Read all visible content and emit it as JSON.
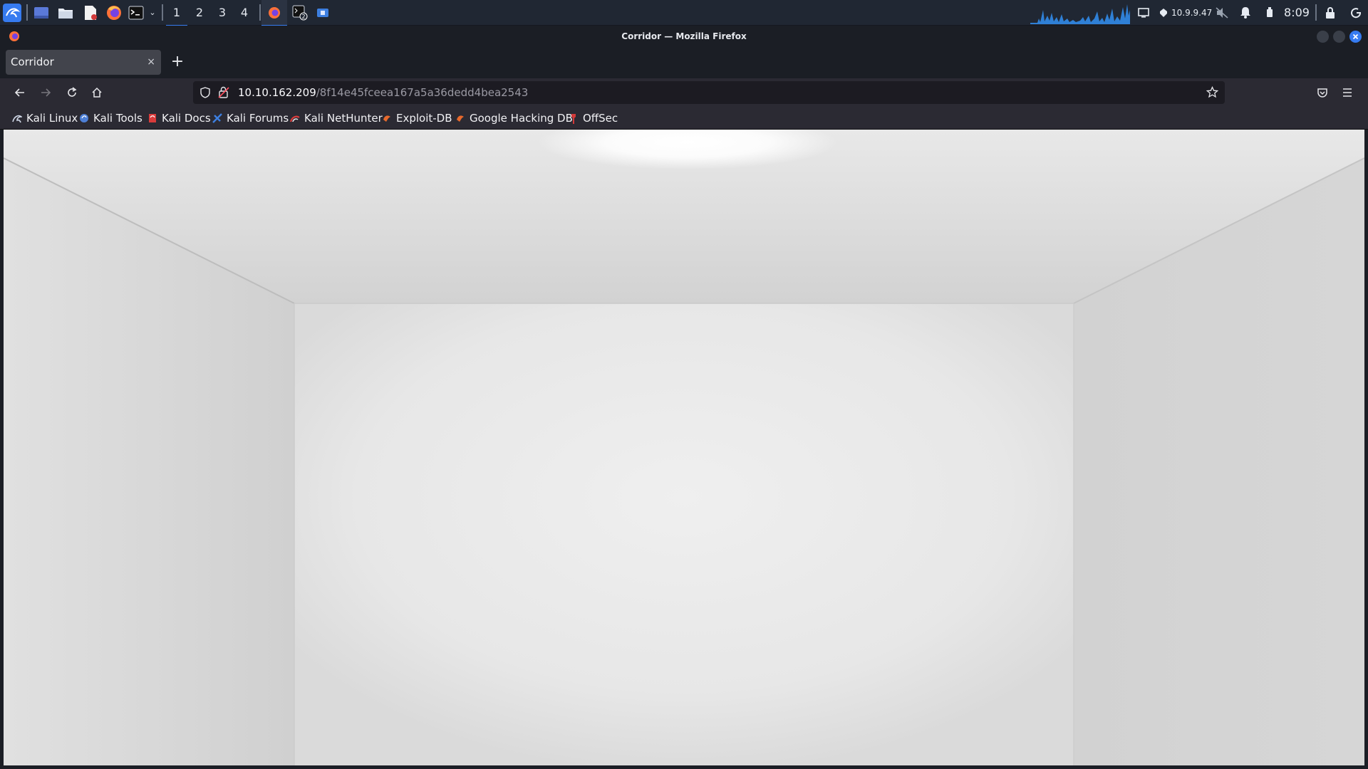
{
  "panel": {
    "workspaces": [
      "1",
      "2",
      "3",
      "4"
    ],
    "active_workspace": "1",
    "ip_address": "10.9.9.47",
    "clock": "8:09",
    "icons": [
      "kali-menu-icon",
      "show-desktop-icon",
      "file-manager-icon",
      "text-editor-icon",
      "firefox-icon",
      "terminal-icon",
      "chevron-down-icon",
      "firefox-task-icon",
      "terminal-task-icon",
      "app-task-icon",
      "network-graph-icon",
      "display-icon",
      "vpn-icon",
      "mute-icon",
      "notification-bell-icon",
      "power-plug-icon",
      "lock-icon",
      "logout-icon"
    ]
  },
  "window": {
    "title": "Corridor — Mozilla Firefox"
  },
  "tabs": [
    {
      "title": "Corridor",
      "close": "×"
    }
  ],
  "new_tab_label": "+",
  "url": {
    "host": "10.10.162.209",
    "path": "/8f14e45fceea167a5a36dedd4bea2543"
  },
  "bookmarks": [
    {
      "label": "Kali Linux",
      "icon": "kali-dragon-icon",
      "color": "#3a5a8a"
    },
    {
      "label": "Kali Tools",
      "icon": "kali-tools-icon",
      "color": "#4d7fd6"
    },
    {
      "label": "Kali Docs",
      "icon": "kali-docs-icon",
      "color": "#d93b3b"
    },
    {
      "label": "Kali Forums",
      "icon": "kali-forums-icon",
      "color": "#3d7fe0"
    },
    {
      "label": "Kali NetHunter",
      "icon": "nethunter-icon",
      "color": "#d93b3b"
    },
    {
      "label": "Exploit-DB",
      "icon": "exploit-db-icon",
      "color": "#e8692c"
    },
    {
      "label": "Google Hacking DB",
      "icon": "ghdb-icon",
      "color": "#e8692c"
    },
    {
      "label": "OffSec",
      "icon": "offsec-icon",
      "color": "#d23a3a"
    }
  ],
  "colors": {
    "accent": "#367bf0",
    "panel_bg": "#202733",
    "browser_bg": "#2b2a33",
    "room_wall": "#e6e6e6"
  }
}
